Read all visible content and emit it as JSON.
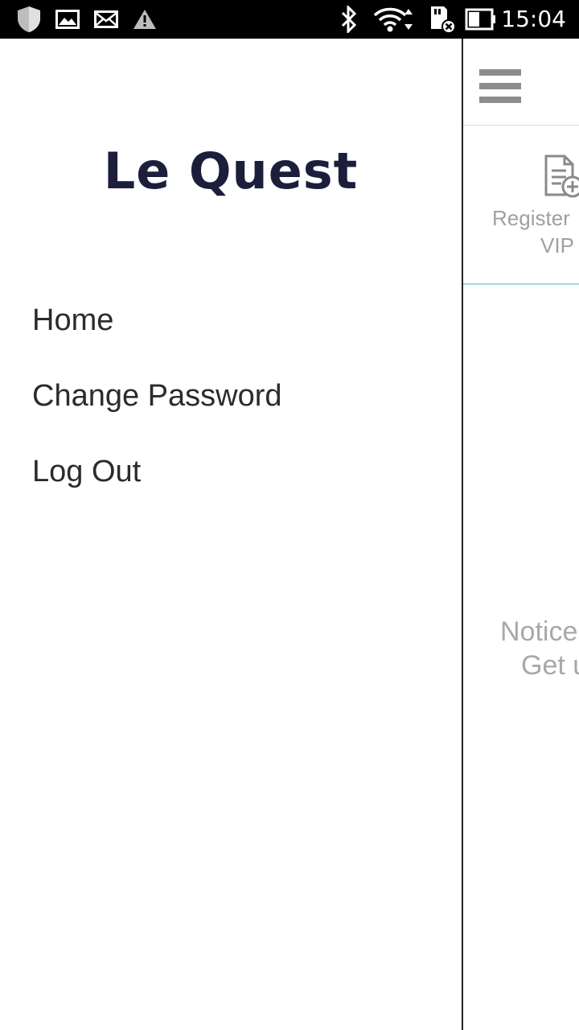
{
  "status_bar": {
    "time": "15:04",
    "left_icons": [
      "shield-icon",
      "image-icon",
      "mail-icon",
      "warning-icon"
    ],
    "right_icons": [
      "bluetooth-icon",
      "wifi-icon",
      "sd-card-icon",
      "battery-icon"
    ]
  },
  "drawer": {
    "title": "Le Quest",
    "items": [
      {
        "label": "Home"
      },
      {
        "label": "Change Password"
      },
      {
        "label": "Log Out"
      }
    ]
  },
  "main": {
    "menu_icon": "hamburger-menu-icon",
    "register": {
      "line1": "Register",
      "line2": "VIP",
      "icon": "document-add-icon"
    },
    "notice": {
      "line1": "Notice",
      "line2": "Get u"
    }
  },
  "colors": {
    "title": "#1b1f3b",
    "accent_line": "#a9d7dc",
    "muted_text": "#a0a0a0"
  }
}
